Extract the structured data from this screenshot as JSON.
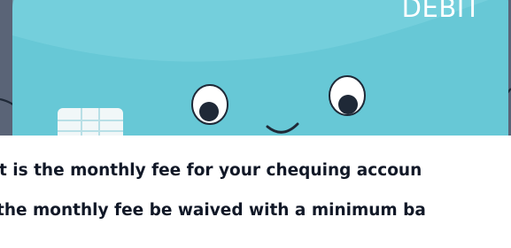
{
  "illustration": {
    "card_label": "DEBIT",
    "colors": {
      "background": "#5a6477",
      "card": "#67c8d6",
      "card_highlight": "#7fd6e1",
      "chip": "#f1f7f8",
      "outline": "#1f2937"
    }
  },
  "questions": [
    {
      "text": "t is the monthly fee for your chequing accoun"
    },
    {
      "text": " the monthly fee be waived with a minimum ba"
    }
  ]
}
